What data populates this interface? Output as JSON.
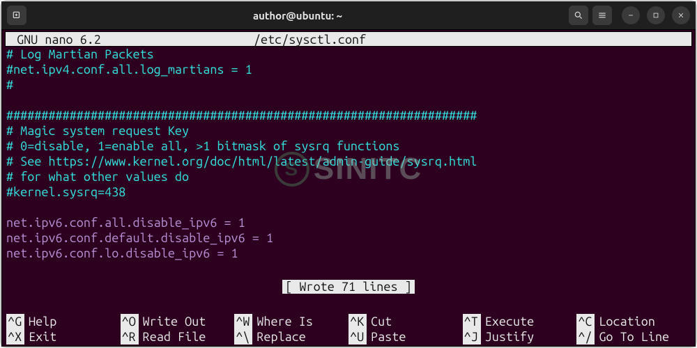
{
  "titlebar": {
    "title": "author@ubuntu: ~"
  },
  "nano": {
    "app": "GNU nano 6.2",
    "filename": "/etc/sysctl.conf"
  },
  "content": {
    "lines": [
      {
        "cls": "c",
        "text": "# Log Martian Packets"
      },
      {
        "cls": "c",
        "text": "#net.ipv4.conf.all.log_martians = 1"
      },
      {
        "cls": "c",
        "text": "#"
      },
      {
        "cls": "c",
        "text": ""
      },
      {
        "cls": "c",
        "text": "###################################################################"
      },
      {
        "cls": "c",
        "text": "# Magic system request Key"
      },
      {
        "cls": "c",
        "text": "# 0=disable, 1=enable all, >1 bitmask of sysrq functions"
      },
      {
        "cls": "c",
        "text": "# See https://www.kernel.org/doc/html/latest/admin-guide/sysrq.html"
      },
      {
        "cls": "c",
        "text": "# for what other values do"
      },
      {
        "cls": "c",
        "text": "#kernel.sysrq=438"
      },
      {
        "cls": "p",
        "text": ""
      },
      {
        "cls": "p",
        "text": "net.ipv6.conf.all.disable_ipv6 = 1"
      },
      {
        "cls": "p",
        "text": "net.ipv6.conf.default.disable_ipv6 = 1"
      },
      {
        "cls": "p",
        "text": "net.ipv6.conf.lo.disable_ipv6 = 1"
      },
      {
        "cls": "p",
        "text": ""
      }
    ]
  },
  "status": "[ Wrote 71 lines ]",
  "shortcuts": [
    {
      "key": "^G",
      "label": "Help"
    },
    {
      "key": "^O",
      "label": "Write Out"
    },
    {
      "key": "^W",
      "label": "Where Is"
    },
    {
      "key": "^K",
      "label": "Cut"
    },
    {
      "key": "^T",
      "label": "Execute"
    },
    {
      "key": "^C",
      "label": "Location"
    },
    {
      "key": "^X",
      "label": "Exit"
    },
    {
      "key": "^R",
      "label": "Read File"
    },
    {
      "key": "^\\",
      "label": "Replace"
    },
    {
      "key": "^U",
      "label": "Paste"
    },
    {
      "key": "^J",
      "label": "Justify"
    },
    {
      "key": "^/",
      "label": "Go To Line"
    }
  ],
  "watermark": {
    "text": "SINITC",
    "circle": "S"
  }
}
